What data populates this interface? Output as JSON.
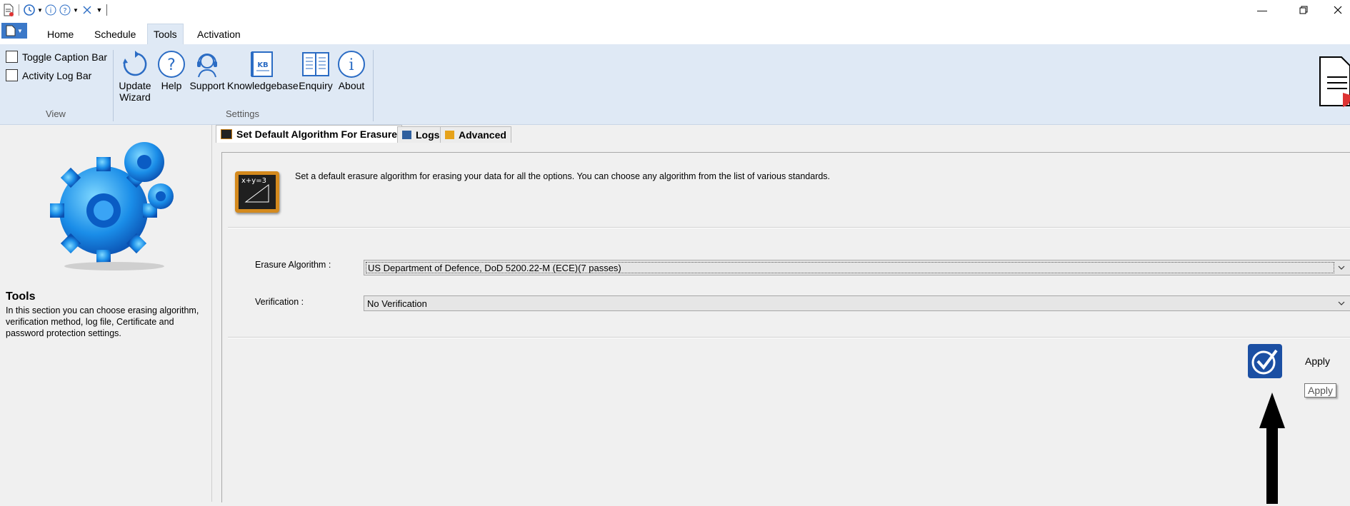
{
  "ribbon": {
    "tabs": [
      {
        "label": "Home"
      },
      {
        "label": "Schedule"
      },
      {
        "label": "Tools"
      },
      {
        "label": "Activation"
      }
    ],
    "view_group": {
      "label": "View",
      "toggle_caption_bar": "Toggle Caption Bar",
      "activity_log_bar": "Activity Log Bar"
    },
    "settings_group": {
      "label": "Settings",
      "update_wizard_line1": "Update",
      "update_wizard_line2": "Wizard",
      "help": "Help",
      "support": "Support",
      "knowledgebase": "Knowledgebase",
      "enquiry": "Enquiry",
      "about": "About"
    }
  },
  "left_panel": {
    "title": "Tools",
    "description": "In this section you can choose erasing algorithm, verification method, log file, Certificate and password protection settings."
  },
  "panel_tabs": [
    {
      "label": "Set Default Algorithm For Erasure"
    },
    {
      "label": "Logs"
    },
    {
      "label": "Advanced"
    }
  ],
  "main": {
    "intro": "Set a default erasure algorithm for erasing your data for all the options. You can choose any algorithm from the list of various standards.",
    "chalkboard_text": "x+y=3",
    "erasure_label": "Erasure Algorithm :",
    "erasure_value": "US Department of Defence, DoD 5200.22-M (ECE)(7 passes)",
    "verification_label": "Verification :",
    "verification_value": "No Verification",
    "apply_label": "Apply",
    "apply_tooltip": "Apply"
  },
  "colors": {
    "ribbon_bg": "#dfe9f5",
    "icon_blue": "#2b6cc4",
    "chalkboard_frame": "#d48a1e"
  }
}
